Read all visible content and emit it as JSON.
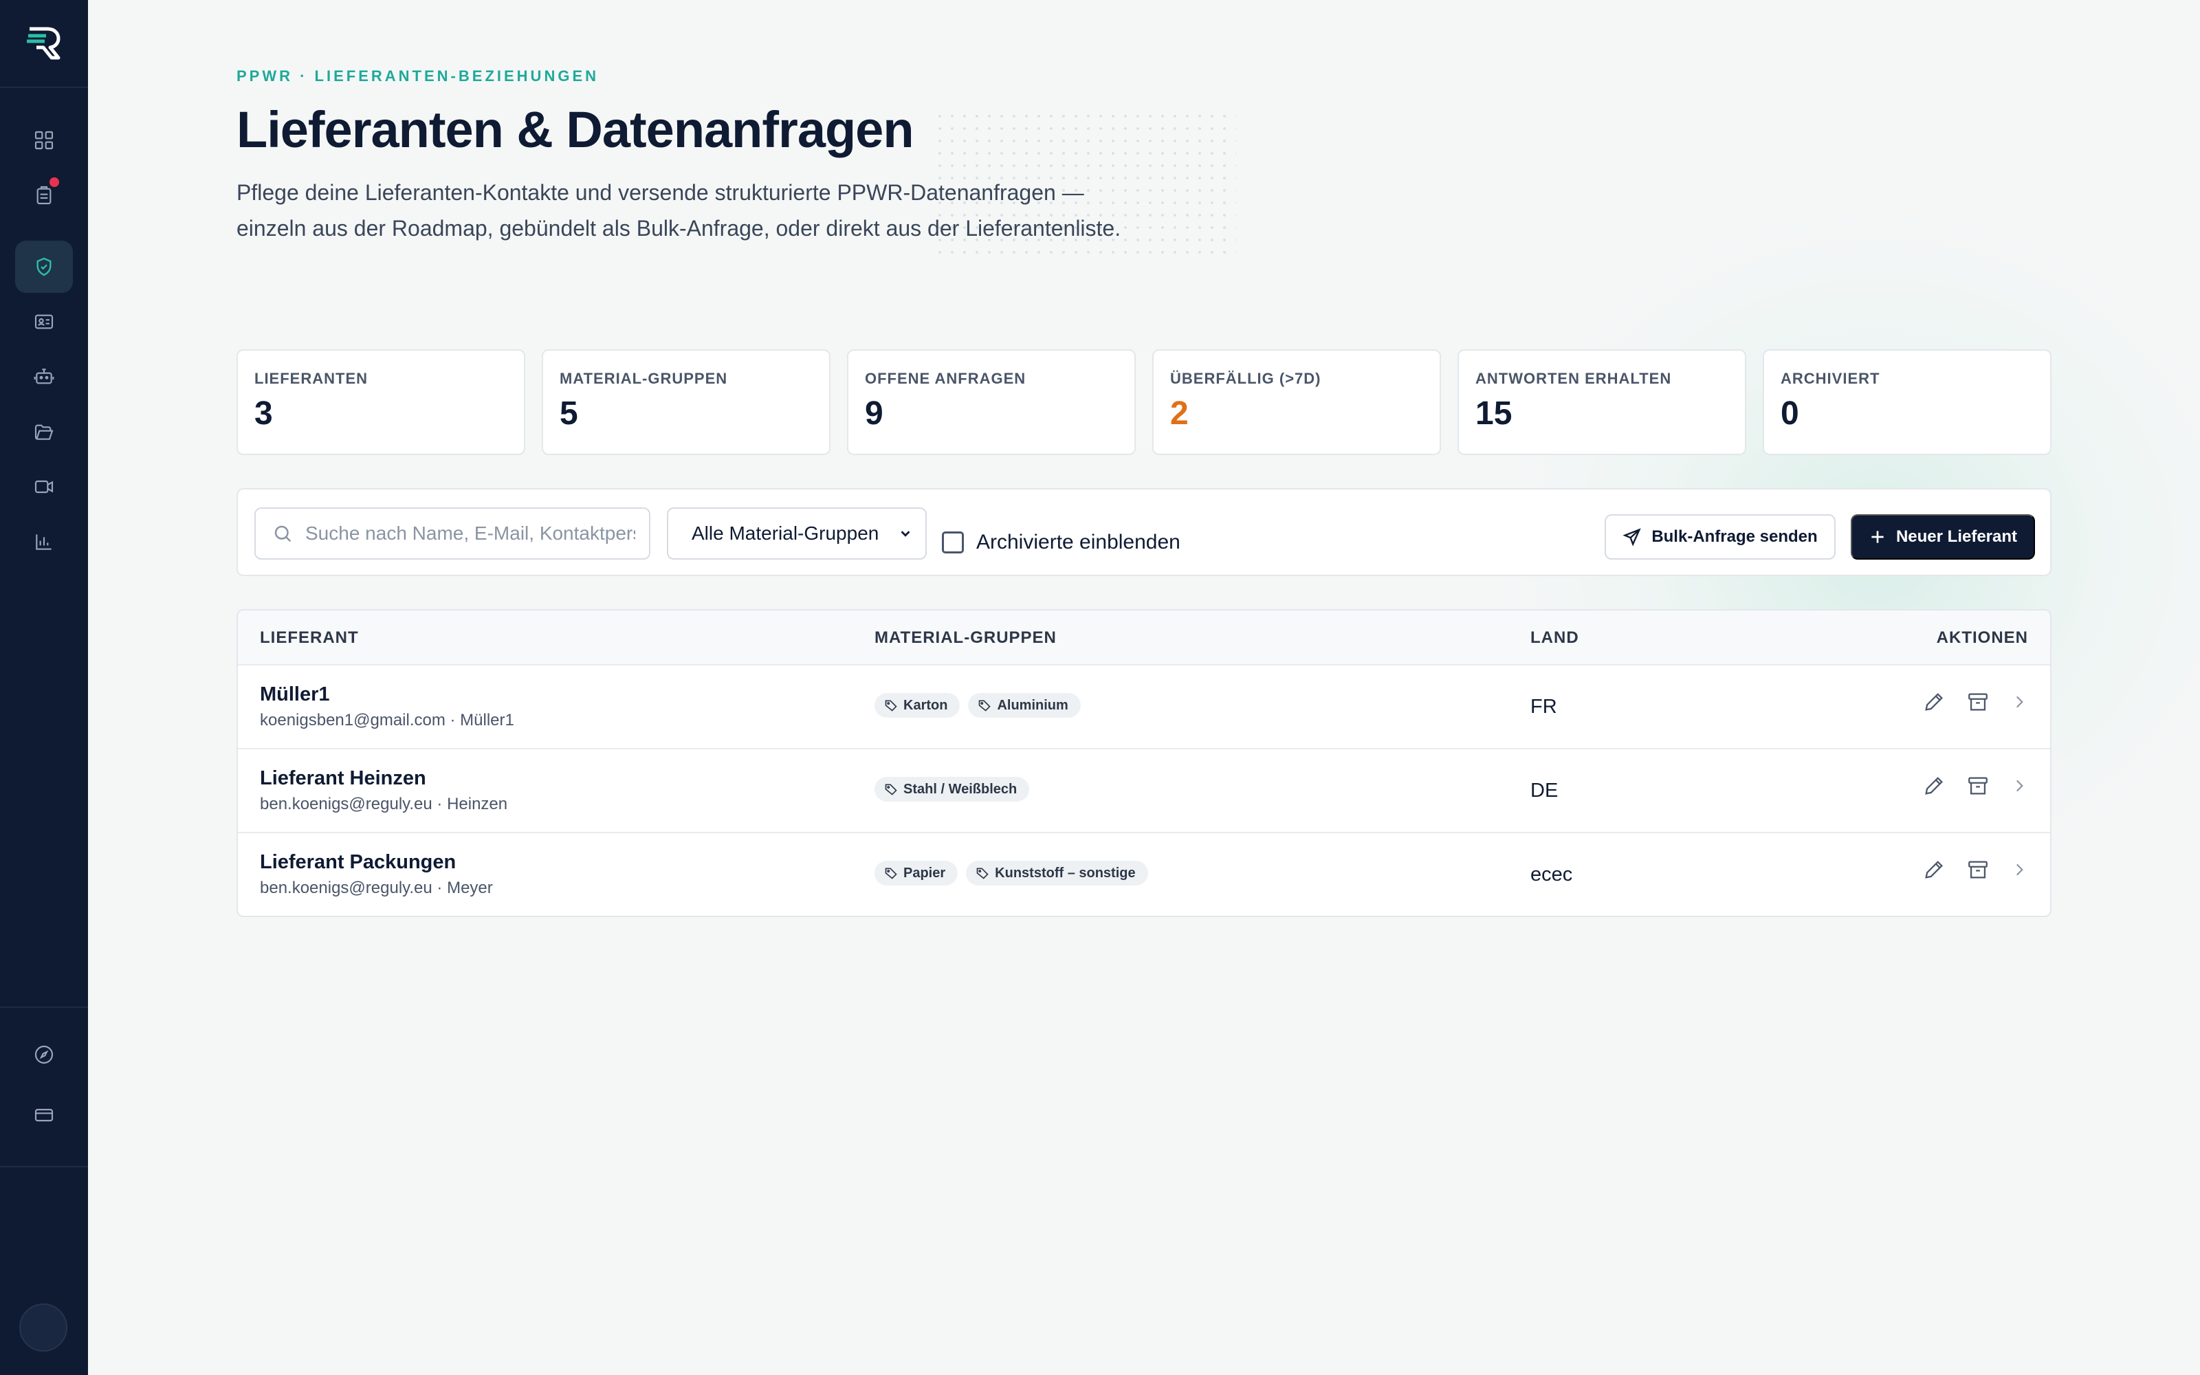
{
  "header": {
    "eyebrow": "PPWR · LIEFERANTEN-BEZIEHUNGEN",
    "title": "Lieferanten & Datenanfragen",
    "subtitle": "Pflege deine Lieferanten-Kontakte und versende strukturierte PPWR-Datenanfragen — einzeln aus der Roadmap, gebündelt als Bulk-Anfrage, oder direkt aus der Lieferantenliste."
  },
  "stats": [
    {
      "label": "LIEFERANTEN",
      "value": "3"
    },
    {
      "label": "MATERIAL-GRUPPEN",
      "value": "5"
    },
    {
      "label": "OFFENE ANFRAGEN",
      "value": "9"
    },
    {
      "label": "ÜBERFÄLLIG (>7D)",
      "value": "2",
      "color": "#e07016"
    },
    {
      "label": "ANTWORTEN ERHALTEN",
      "value": "15"
    },
    {
      "label": "ARCHIVIERT",
      "value": "0"
    }
  ],
  "toolbar": {
    "search_placeholder": "Suche nach Name, E-Mail, Kontaktperson",
    "search_value": "",
    "material_filter": "Alle Material-Gruppen",
    "archived_label": "Archivierte einblenden",
    "bulk_label": "Bulk-Anfrage senden",
    "new_label": "Neuer Lieferant"
  },
  "table": {
    "columns": [
      "LIEFERANT",
      "MATERIAL-GRUPPEN",
      "LAND",
      "AKTIONEN"
    ],
    "rows": [
      {
        "name": "Müller1",
        "meta": "koenigsben1@gmail.com · Müller1",
        "tags": [
          "Karton",
          "Aluminium"
        ],
        "land": "FR"
      },
      {
        "name": "Lieferant Heinzen",
        "meta": "ben.koenigs@reguly.eu · Heinzen",
        "tags": [
          "Stahl / Weißblech"
        ],
        "land": "DE"
      },
      {
        "name": "Lieferant Packungen",
        "meta": "ben.koenigs@reguly.eu · Meyer",
        "tags": [
          "Papier",
          "Kunststoff – sonstige"
        ],
        "land": "ecec"
      }
    ]
  },
  "colors": {
    "accent": "#1fa99a",
    "navy": "#0f1b33",
    "warning": "#e07016",
    "notification": "#e8334f"
  },
  "icons": {
    "sidebar": [
      "dashboard-icon",
      "clipboard-icon",
      "shield-check-icon",
      "id-card-icon",
      "robot-icon",
      "folder-open-icon",
      "video-icon",
      "bar-chart-icon",
      "compass-icon",
      "credit-card-icon"
    ],
    "row_actions": [
      "pencil-icon",
      "archive-icon",
      "chevron-right-icon"
    ]
  }
}
